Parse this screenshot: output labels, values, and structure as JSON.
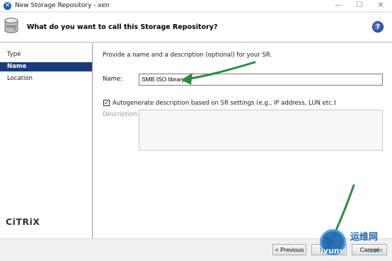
{
  "window": {
    "title": "New Storage Repository - xen",
    "minimize_glyph": "—",
    "maximize_glyph": "☐",
    "close_glyph": "✕"
  },
  "header": {
    "title": "What do you want to call this Storage Repository?",
    "help_glyph": "?"
  },
  "sidebar": {
    "items": [
      {
        "label": "Type",
        "selected": false
      },
      {
        "label": "Name",
        "selected": true
      },
      {
        "label": "Location",
        "selected": false
      }
    ],
    "logo_text": "CiTRiX"
  },
  "form": {
    "intro": "Provide a name and a description (optional) for your SR.",
    "name_label": "Name:",
    "name_value": "SMB ISO library",
    "autogen_checked": true,
    "autogen_label": "Autogenerate description based on SR settings (e.g., IP address, LUN etc.)",
    "description_label": "Description:",
    "description_value": ""
  },
  "footer": {
    "previous_label": "< Previous",
    "next_label": "Next >",
    "cancel_label": "Cancel"
  },
  "watermark": {
    "cn_text": "运维网",
    "url_text": "iyunv",
    "suffix_text": ".com"
  },
  "colors": {
    "selection": "#1b3a7a",
    "arrow": "#2e8b3a",
    "help_blue": "#1c3f92"
  }
}
